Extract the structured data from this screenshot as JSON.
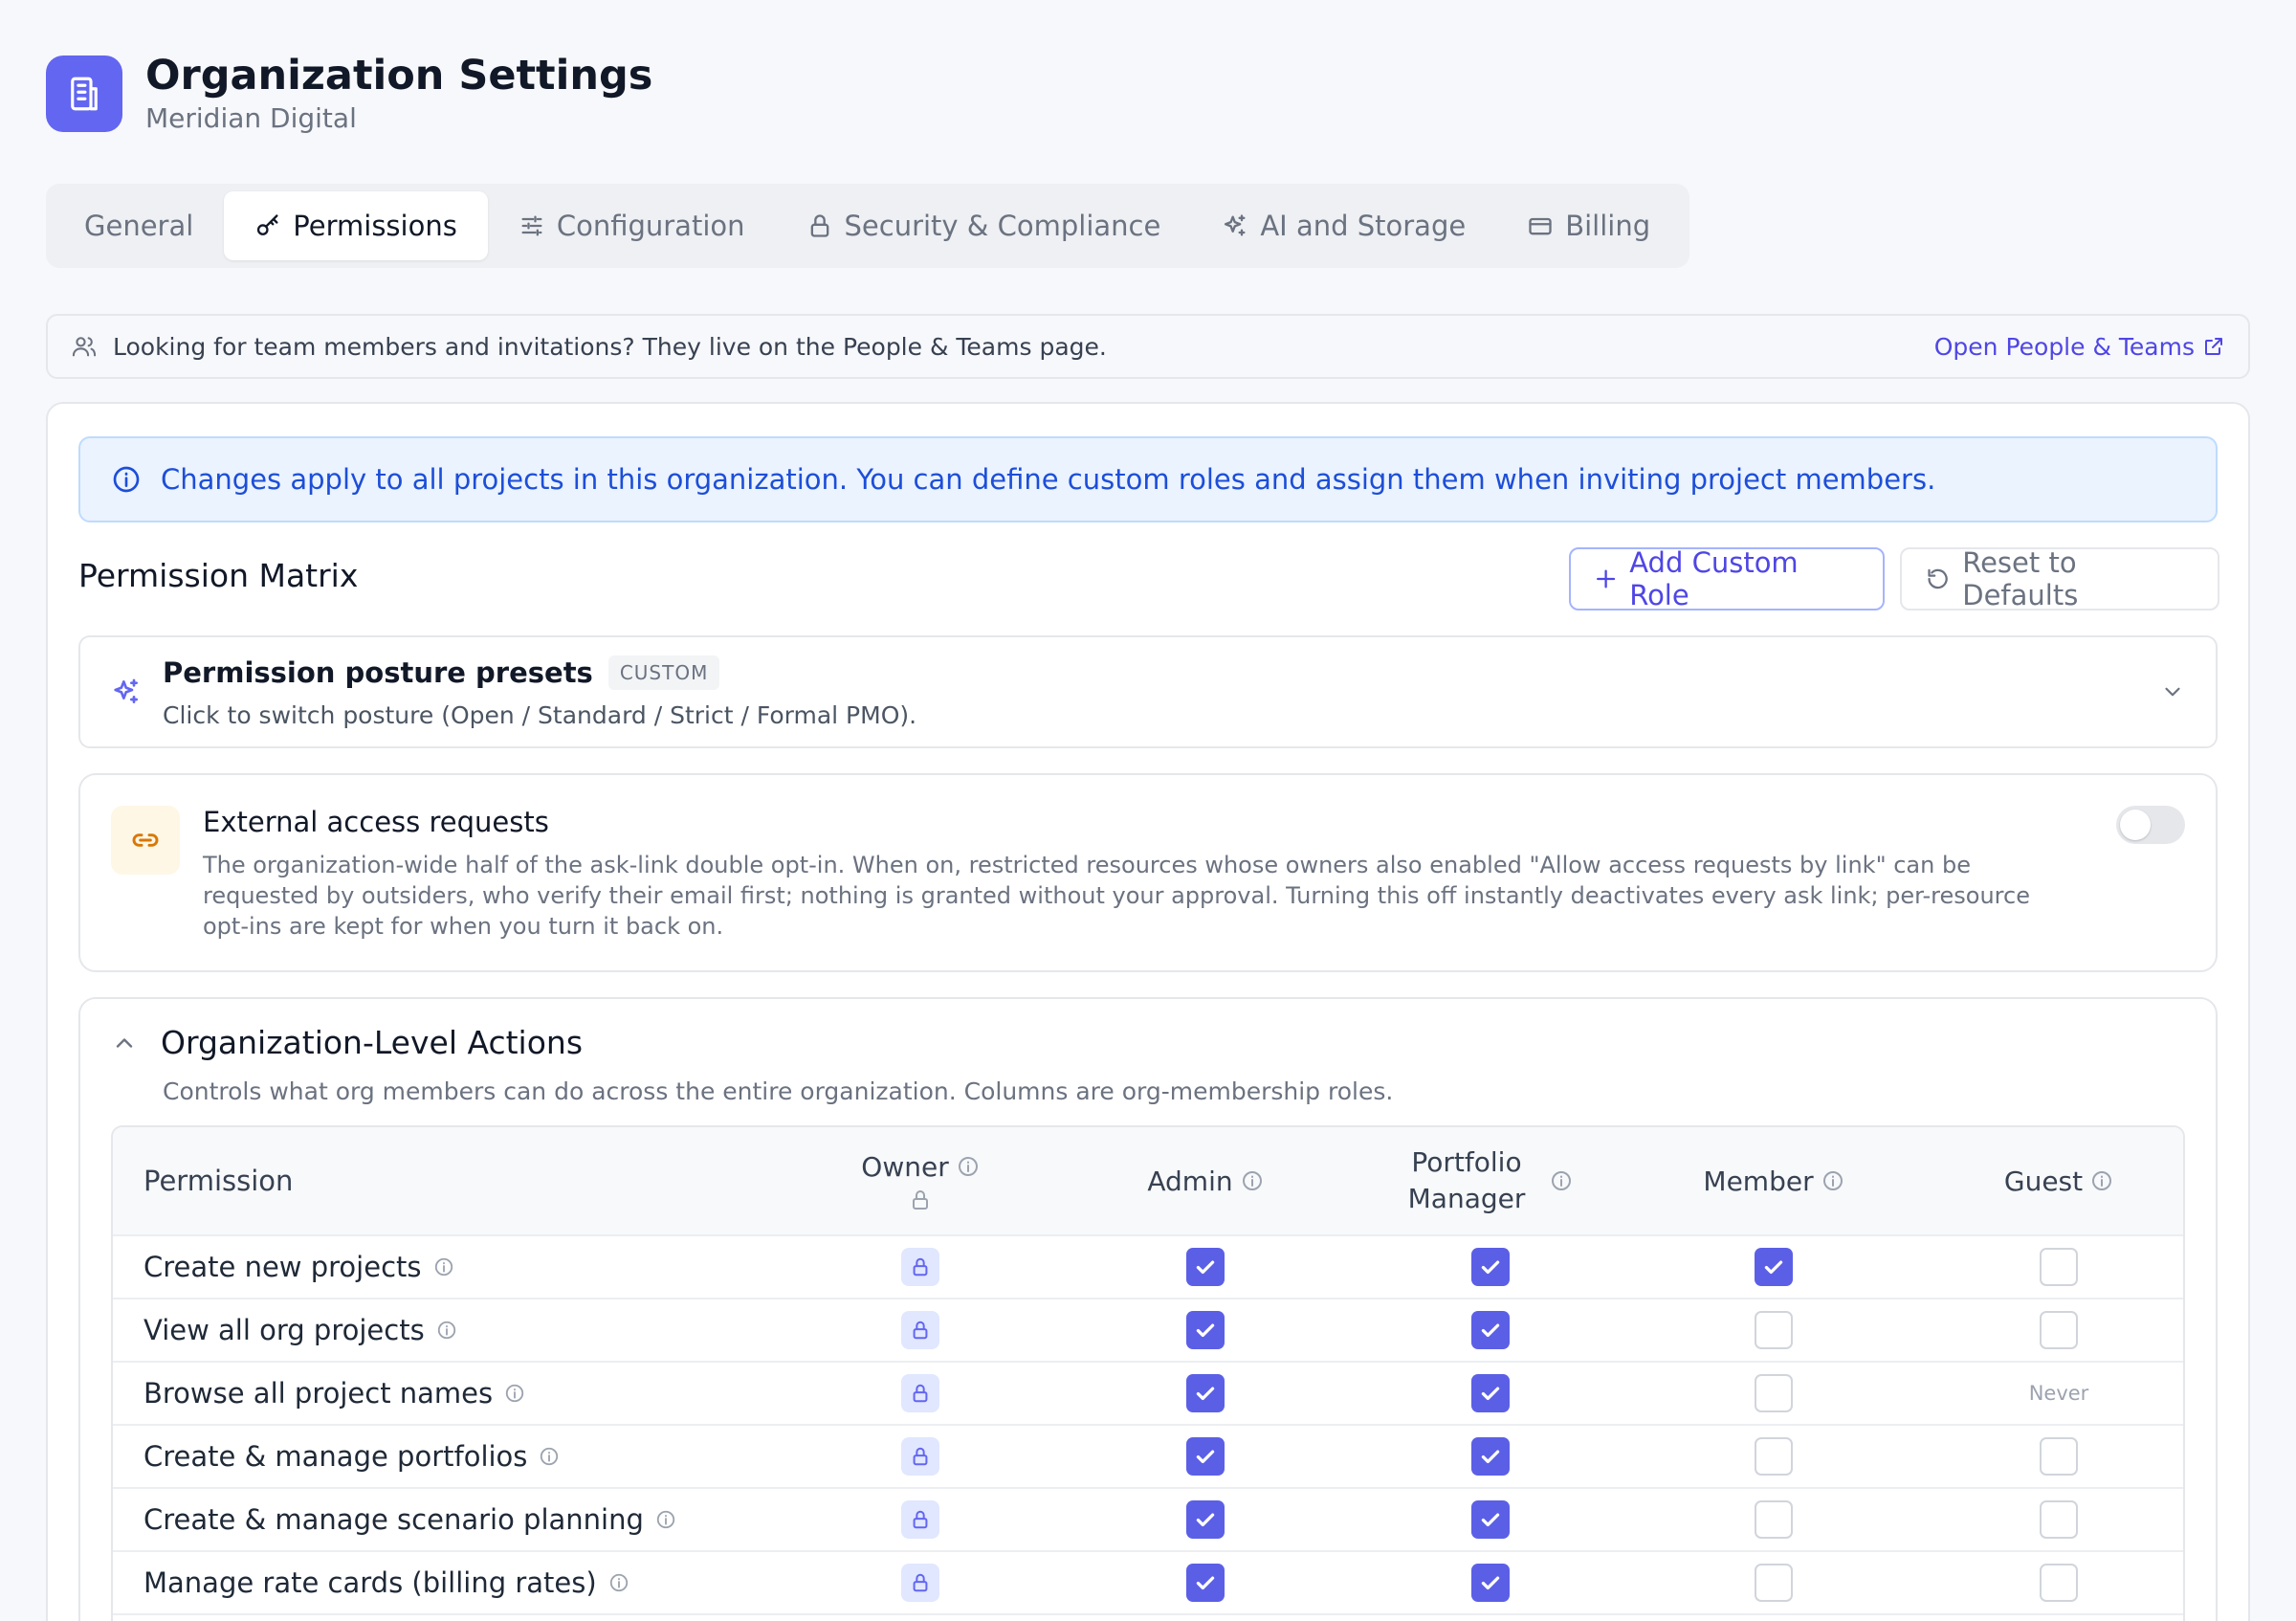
{
  "header": {
    "title": "Organization Settings",
    "org_name": "Meridian Digital",
    "logo_icon": "building-icon",
    "accent_color": "#6366f1"
  },
  "tabs": [
    {
      "label": "General",
      "icon": "",
      "active": false
    },
    {
      "label": "Permissions",
      "icon": "key-icon",
      "active": true
    },
    {
      "label": "Configuration",
      "icon": "sliders-icon",
      "active": false
    },
    {
      "label": "Security & Compliance",
      "icon": "lock-icon",
      "active": false
    },
    {
      "label": "AI and Storage",
      "icon": "sparkles-icon",
      "active": false
    },
    {
      "label": "Billing",
      "icon": "credit-card-icon",
      "active": false
    }
  ],
  "notice": {
    "text": "Looking for team members and invitations? They live on the People & Teams page.",
    "link_label": "Open People & Teams"
  },
  "info_banner": {
    "text": "Changes apply to all projects in this organization. You can define custom roles and assign them when inviting project members."
  },
  "matrix_section": {
    "title": "Permission Matrix",
    "add_role_label": "Add Custom Role",
    "reset_label": "Reset to Defaults"
  },
  "presets": {
    "title": "Permission posture presets",
    "badge": "CUSTOM",
    "subtitle": "Click to switch posture (Open / Standard / Strict / Formal PMO)."
  },
  "external_access": {
    "title": "External access requests",
    "description": "The organization-wide half of the ask-link double opt-in. When on, restricted resources whose owners also enabled \"Allow access requests by link\" can be requested by outsiders, who verify their email first; nothing is granted without your approval. Turning this off instantly deactivates every ask link; per-resource opt-ins are kept for when you turn it back on.",
    "enabled": false
  },
  "org_actions": {
    "title": "Organization-Level Actions",
    "subtitle": "Controls what org members can do across the entire organization. Columns are org-membership roles.",
    "expanded": true,
    "columns": {
      "permission": "Permission",
      "owner": "Owner",
      "admin": "Admin",
      "portfolio_manager_line1": "Portfolio",
      "portfolio_manager_line2": "Manager",
      "member": "Member",
      "guest": "Guest"
    },
    "rows": [
      {
        "label": "Create new projects",
        "owner": "locked",
        "admin": true,
        "portfolio_manager": true,
        "member": true,
        "guest": false
      },
      {
        "label": "View all org projects",
        "owner": "locked",
        "admin": true,
        "portfolio_manager": true,
        "member": false,
        "guest": false
      },
      {
        "label": "Browse all project names",
        "owner": "locked",
        "admin": true,
        "portfolio_manager": true,
        "member": false,
        "guest": "Never"
      },
      {
        "label": "Create & manage portfolios",
        "owner": "locked",
        "admin": true,
        "portfolio_manager": true,
        "member": false,
        "guest": false
      },
      {
        "label": "Create & manage scenario planning",
        "owner": "locked",
        "admin": true,
        "portfolio_manager": true,
        "member": false,
        "guest": false
      },
      {
        "label": "Manage rate cards (billing rates)",
        "owner": "locked",
        "admin": true,
        "portfolio_manager": true,
        "member": false,
        "guest": false
      }
    ]
  }
}
